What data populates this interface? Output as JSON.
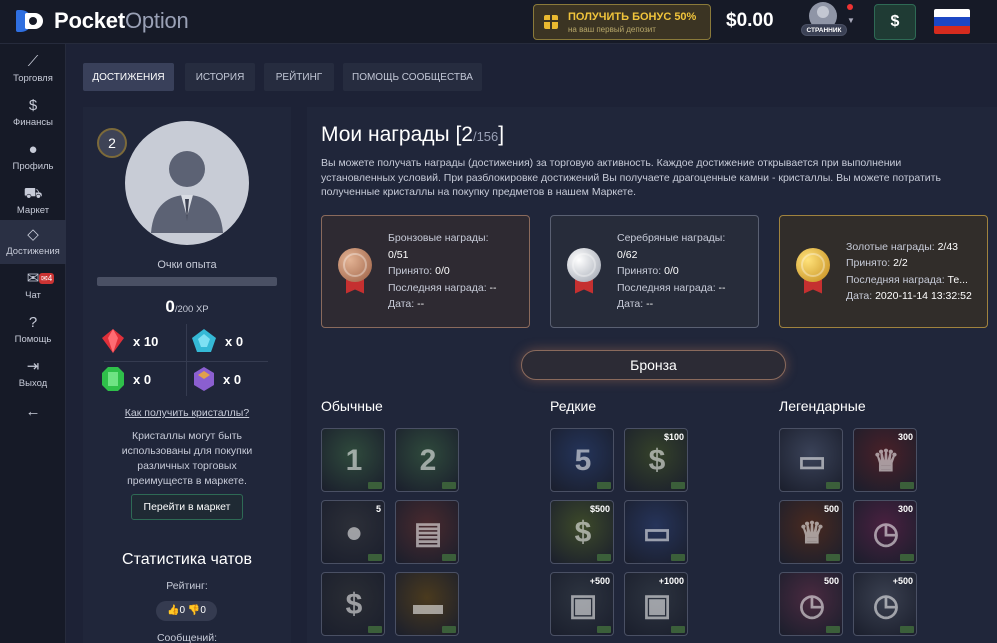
{
  "header": {
    "logo_bold": "Pocket",
    "logo_light": "Option",
    "bonus_title": "ПОЛУЧИТЬ БОНУС 50%",
    "bonus_sub": "на ваш первый депозит",
    "balance": "$0.00",
    "user_badge": "СТРАННИК",
    "deposit_symbol": "$"
  },
  "sidebar": {
    "items": [
      {
        "icon": "chart-icon",
        "glyph": "⟋",
        "label": "Торговля"
      },
      {
        "icon": "dollar-icon",
        "glyph": "$",
        "label": "Финансы"
      },
      {
        "icon": "user-icon",
        "glyph": "●",
        "label": "Профиль"
      },
      {
        "icon": "cart-icon",
        "glyph": "⛟",
        "label": "Маркет"
      },
      {
        "icon": "diamond-icon",
        "glyph": "◇",
        "label": "Достижения"
      },
      {
        "icon": "chat-icon",
        "glyph": "✉",
        "label": "Чат"
      },
      {
        "icon": "help-icon",
        "glyph": "?",
        "label": "Помощь"
      },
      {
        "icon": "exit-icon",
        "glyph": "⇥",
        "label": "Выход"
      },
      {
        "icon": "arrow-left-icon",
        "glyph": "←",
        "label": ""
      }
    ],
    "chat_count": "✉4"
  },
  "tabs": [
    "ДОСТИЖЕНИЯ",
    "ИСТОРИЯ",
    "РЕЙТИНГ",
    "ПОМОЩЬ СООБЩЕСТВА"
  ],
  "profile": {
    "level": "2",
    "xp_label": "Очки опыта",
    "xp_current": "0",
    "xp_total": "/200 XP",
    "xp_progress": 0,
    "crystals": [
      {
        "name": "red-crystal-icon",
        "color": "#e0303a",
        "count": "x 10"
      },
      {
        "name": "blue-crystal-icon",
        "color": "#35b9d6",
        "count": "x 0"
      },
      {
        "name": "green-crystal-icon",
        "color": "#2fc04a",
        "count": "x 0"
      },
      {
        "name": "purple-crystal-icon",
        "color": "#8b5fd0",
        "count": "x 0"
      }
    ],
    "crystals_link": "Как получить кристаллы?",
    "crystals_desc": "Кристаллы могут быть использованы для покупки различных торговых преимуществ в маркете.",
    "market_button": "Перейти в маркет",
    "chat_stats_title": "Статистика чатов",
    "rating_label": "Рейтинг:",
    "rating_value": "👍0 👎0",
    "messages_label": "Сообщений:"
  },
  "main": {
    "title": "Мои награды [2",
    "title_sub": "/156",
    "title_end": "]",
    "intro": "Вы можете получать награды (достижения) за торговую активность. Каждое достижение открывается при выполнении установленных условий. При разблокировке достижений Вы получаете драгоценные камни - кристаллы. Вы можете потратить полученные кристаллы на покупку предметов в нашем Маркете.",
    "cards": {
      "bronze": {
        "title": "Бронзовые награды:",
        "count": "0/51",
        "accepted_label": "Принято:",
        "accepted": "0/0",
        "last_label": "Последняя награда:",
        "last": "--",
        "date_label": "Дата:",
        "date": "--"
      },
      "silver": {
        "title": "Серебряные награды:",
        "count": "0/62",
        "accepted_label": "Принято:",
        "accepted": "0/0",
        "last_label": "Последняя награда:",
        "last": "--",
        "date_label": "Дата:",
        "date": "--"
      },
      "gold": {
        "title": "Золотые награды:",
        "count": "2/43",
        "accepted_label": "Принято:",
        "accepted": "2/2",
        "last_label": "Последняя награда:",
        "last": "Те...",
        "date_label": "Дата:",
        "date": "2020-11-14 13:32:52"
      }
    },
    "tier_button": "Бронза",
    "columns": {
      "common": "Обычные",
      "rare": "Редкие",
      "legendary": "Легендарные"
    },
    "badges": {
      "common": [
        {
          "glyph": "1",
          "price": "",
          "bg": "#2f4a3c"
        },
        {
          "glyph": "2",
          "price": "",
          "bg": "#2f4a3c"
        },
        {
          "glyph": "●",
          "price": "5",
          "bg": "#2c2f38"
        },
        {
          "glyph": "▤",
          "price": "",
          "bg": "#4a2a2e"
        },
        {
          "glyph": "$",
          "price": "",
          "bg": "#2a2d34"
        },
        {
          "glyph": "▬",
          "price": "",
          "bg": "#4a3a1e"
        }
      ],
      "rare": [
        {
          "glyph": "5",
          "price": "",
          "bg": "#24345a"
        },
        {
          "glyph": "$",
          "price": "$100",
          "bg": "#35422a"
        },
        {
          "glyph": "$",
          "price": "$500",
          "bg": "#3d4a2a"
        },
        {
          "glyph": "▭",
          "price": "",
          "bg": "#26345a"
        },
        {
          "glyph": "▣",
          "price": "+500",
          "bg": "#2d3440"
        },
        {
          "glyph": "▣",
          "price": "+1000",
          "bg": "#2d3440"
        }
      ],
      "legendary": [
        {
          "glyph": "▭",
          "price": "",
          "bg": "#3a4258"
        },
        {
          "glyph": "♛",
          "price": "300",
          "bg": "#4a2028"
        },
        {
          "glyph": "♛",
          "price": "500",
          "bg": "#4a2a20"
        },
        {
          "glyph": "◷",
          "price": "300",
          "bg": "#4a2040"
        },
        {
          "glyph": "◷",
          "price": "500",
          "bg": "#4a2a40"
        },
        {
          "glyph": "◷",
          "price": "+500",
          "bg": "#3a4050"
        }
      ]
    }
  },
  "colors": {
    "bronze": "#b07a5c",
    "silver": "#c8ccd4",
    "gold": "#e0ad2a",
    "accent_green": "#2e6a55"
  }
}
